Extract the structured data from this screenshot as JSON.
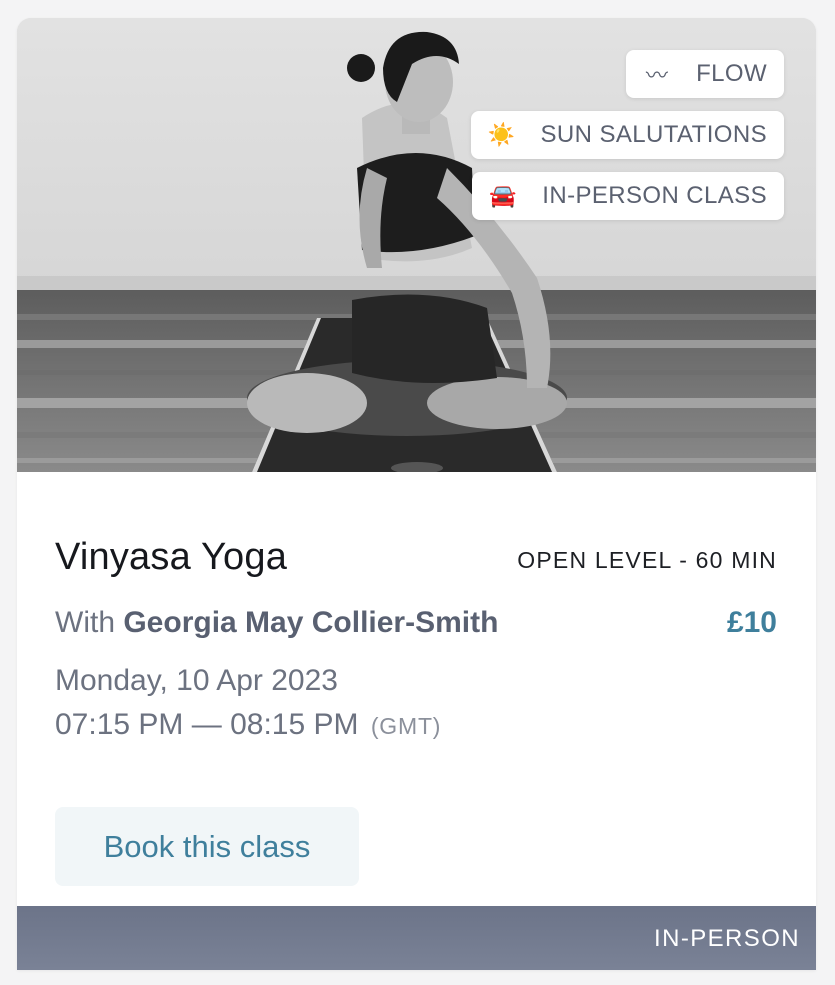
{
  "tags": {
    "flow": {
      "icon": "wave-icon",
      "glyph": "〰",
      "label": "FLOW"
    },
    "sun": {
      "icon": "sun-icon",
      "glyph": "☀️",
      "label": "SUN SALUTATIONS"
    },
    "in_person": {
      "icon": "car-icon",
      "glyph": "🚘",
      "label": "IN-PERSON CLASS"
    }
  },
  "class": {
    "title": "Vinyasa Yoga",
    "level": "OPEN LEVEL - 60 MIN",
    "with_prefix": "With ",
    "instructor": "Georgia May Collier-Smith",
    "price": "£10",
    "date": "Monday, 10 Apr 2023",
    "time": "07:15 PM — 08:15 PM",
    "timezone": "(GMT)"
  },
  "actions": {
    "book_label": "Book this class"
  },
  "footer": {
    "label": "IN-PERSON"
  },
  "colors": {
    "accent": "#3f7f9c",
    "footer_band": "#737b90",
    "muted_text": "#6c7280"
  }
}
